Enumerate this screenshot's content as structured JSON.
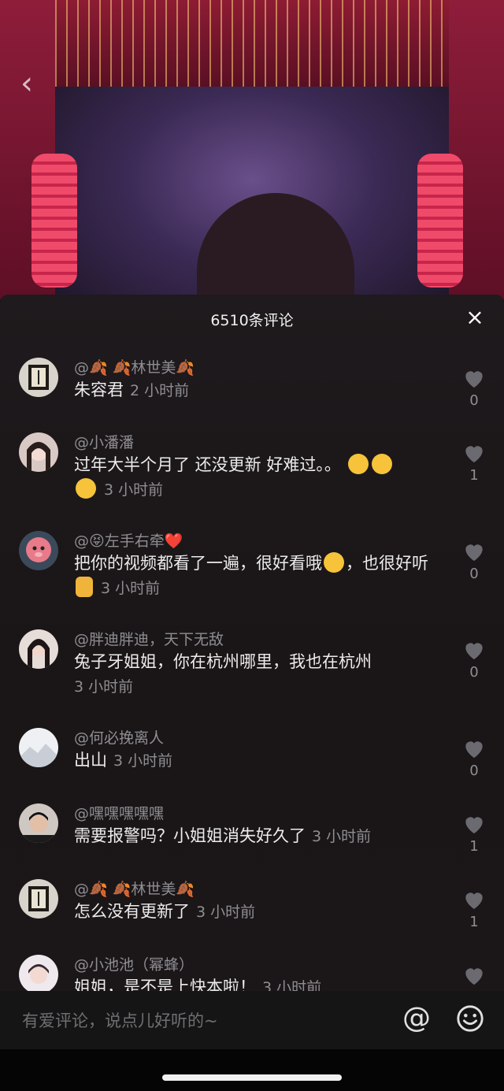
{
  "panel": {
    "title": "6510条评论",
    "close_label": "×"
  },
  "video": {
    "back_label": "‹"
  },
  "comments": [
    {
      "user": "@🍂 🍂林世美🍂",
      "text": "朱容君",
      "time": "2 小时前",
      "likes": "0"
    },
    {
      "user": "@小潘潘",
      "text": "过年大半个月了 还没更新 好难过。。",
      "time": "3 小时前",
      "likes": "1"
    },
    {
      "user": "@😝左手右牵❤️",
      "text": "把你的视频都看了一遍，很好看哦",
      "text2": "，也很好听",
      "time": "3 小时前",
      "likes": "0"
    },
    {
      "user": "@胖迪胖迪，天下无敌",
      "text": "兔子牙姐姐，你在杭州哪里，我也在杭州",
      "time": "3 小时前",
      "likes": "0"
    },
    {
      "user": "@何必挽离人",
      "text": "出山",
      "time": "3 小时前",
      "likes": "0"
    },
    {
      "user": "@嘿嘿嘿嘿嘿",
      "text": "需要报警吗？小姐姐消失好久了",
      "time": "3 小时前",
      "likes": "1"
    },
    {
      "user": "@🍂 🍂林世美🍂",
      "text": "怎么没有更新了",
      "time": "3 小时前",
      "likes": "1"
    },
    {
      "user": "@小池池（幂蜂）",
      "text": "姐姐，是不是上快本啦！",
      "time": "3 小时前",
      "likes": ""
    }
  ],
  "input": {
    "placeholder": "有爱评论，说点儿好听的~",
    "at_label": "@"
  },
  "icons": {
    "heart": "heart-icon",
    "close": "close-icon",
    "back": "chevron-left-icon",
    "emoji": "emoji-icon",
    "at": "at-icon"
  },
  "colors": {
    "panel_bg": "#1a1516",
    "muted": "#8e8e93",
    "text": "#ececec"
  }
}
